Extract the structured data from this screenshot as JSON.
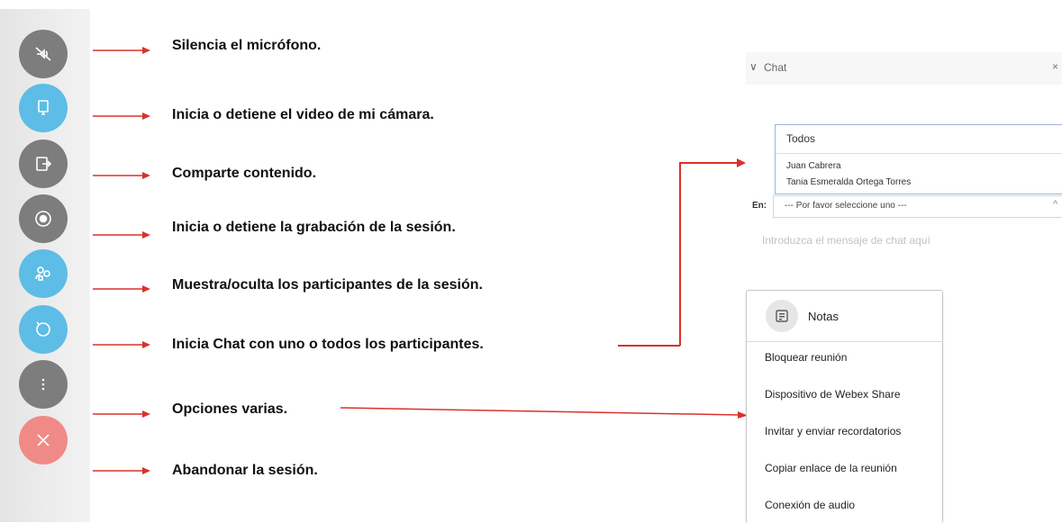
{
  "controls": [
    {
      "icon": "mic-muted-icon",
      "label": "Silencia el micrófono."
    },
    {
      "icon": "camera-icon",
      "label": "Inicia o detiene el video de mi  cámara."
    },
    {
      "icon": "share-icon",
      "label": "Comparte contenido."
    },
    {
      "icon": "record-icon",
      "label": "Inicia o detiene la grabación de la sesión."
    },
    {
      "icon": "participants-icon",
      "label": "Muestra/oculta los participantes de la sesión."
    },
    {
      "icon": "chat-icon",
      "label": "Inicia Chat con uno o todos los participantes."
    },
    {
      "icon": "more-options-icon",
      "label": "Opciones varias."
    },
    {
      "icon": "leave-icon",
      "label": "Abandonar la sesión."
    }
  ],
  "chat": {
    "title": "Chat",
    "recipients": {
      "all": "Todos",
      "items": [
        "Juan Cabrera",
        "Tania Esmeralda Ortega Torres"
      ]
    },
    "to_label": "En:",
    "to_value": "--- Por favor seleccione uno ---",
    "message_placeholder": "Introduzca el mensaje de chat aquí"
  },
  "menu": {
    "notes_label": "Notas",
    "items": [
      "Bloquear reunión",
      "Dispositivo de Webex Share",
      "Invitar y enviar recordatorios",
      "Copiar enlace de la reunión",
      "Conexión de audio"
    ]
  },
  "colors": {
    "gray_button": "#7d7d7d",
    "blue_button": "#5dbde6",
    "red_button": "#f08a86",
    "annotation_red": "#d9322b"
  }
}
